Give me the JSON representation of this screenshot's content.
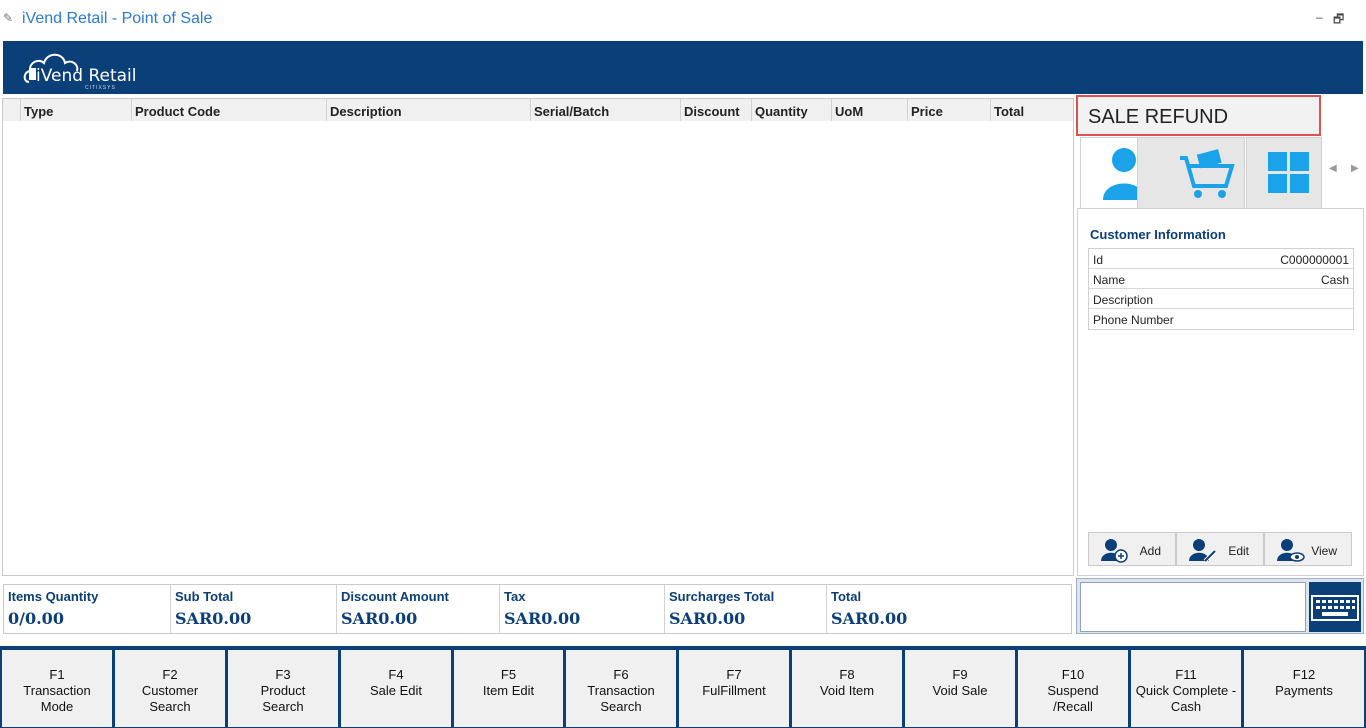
{
  "window": {
    "title": "iVend Retail - Point of Sale",
    "minimize": "–",
    "restore": "🗗"
  },
  "logo": {
    "text": "iVend Retail",
    "sub": "CITIXSYS"
  },
  "grid": {
    "columns": [
      "Type",
      "Product Code",
      "Description",
      "Serial/Batch",
      "Discount",
      "Quantity",
      "UoM",
      "Price",
      "Total"
    ]
  },
  "mode": {
    "label": "SALE REFUND"
  },
  "customer": {
    "title": "Customer Information",
    "rows": [
      {
        "key": "Id",
        "value": "C000000001"
      },
      {
        "key": "Name",
        "value": "Cash"
      },
      {
        "key": "Description",
        "value": ""
      },
      {
        "key": "Phone Number",
        "value": ""
      }
    ],
    "actions": {
      "add": "Add",
      "edit": "Edit",
      "view": "View"
    }
  },
  "totals": [
    {
      "label": "Items Quantity",
      "value": "0/0.00"
    },
    {
      "label": "Sub Total",
      "value": "SAR0.00"
    },
    {
      "label": "Discount Amount",
      "value": "SAR0.00"
    },
    {
      "label": "Tax",
      "value": "SAR0.00"
    },
    {
      "label": "Surcharges Total",
      "value": "SAR0.00"
    },
    {
      "label": "Total",
      "value": "SAR0.00"
    }
  ],
  "fkeys": [
    {
      "key": "F1",
      "l1": "Transaction",
      "l2": "Mode"
    },
    {
      "key": "F2",
      "l1": "Customer",
      "l2": "Search"
    },
    {
      "key": "F3",
      "l1": "Product",
      "l2": "Search"
    },
    {
      "key": "F4",
      "l1": "Sale Edit",
      "l2": ""
    },
    {
      "key": "F5",
      "l1": "Item Edit",
      "l2": ""
    },
    {
      "key": "F6",
      "l1": "Transaction",
      "l2": "Search"
    },
    {
      "key": "F7",
      "l1": "FulFillment",
      "l2": ""
    },
    {
      "key": "F8",
      "l1": "Void Item",
      "l2": ""
    },
    {
      "key": "F9",
      "l1": "Void Sale",
      "l2": ""
    },
    {
      "key": "F10",
      "l1": "Suspend",
      "l2": "/Recall"
    },
    {
      "key": "F11",
      "l1": "Quick Complete -",
      "l2": "Cash"
    },
    {
      "key": "F12",
      "l1": "Payments",
      "l2": ""
    }
  ],
  "colors": {
    "brand": "#0b3f78",
    "accent": "#1aa3e8",
    "highlight": "#e05050"
  }
}
